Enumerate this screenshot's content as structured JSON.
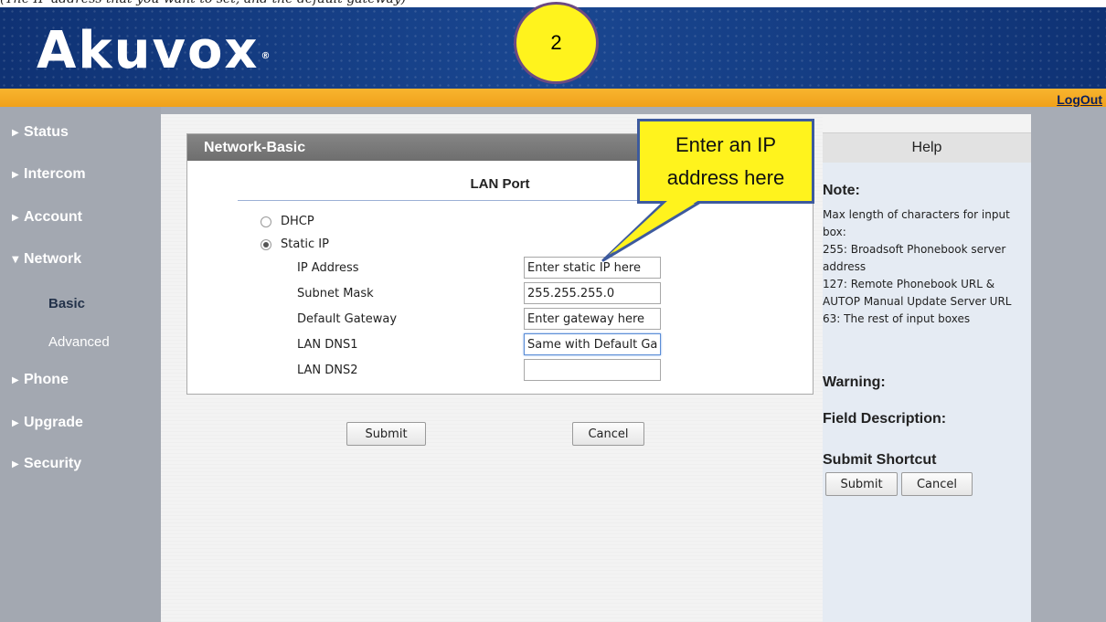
{
  "caption": "(The IP address that you want to set, and the default gateway)",
  "header": {
    "logo": "Akuvox",
    "logo_mark": "®",
    "step_badge": "2"
  },
  "top_bar": {
    "logout_label": "LogOut"
  },
  "sidebar": {
    "items": [
      {
        "label": "Status",
        "expanded": false
      },
      {
        "label": "Intercom",
        "expanded": false
      },
      {
        "label": "Account",
        "expanded": false
      },
      {
        "label": "Network",
        "expanded": true
      },
      {
        "label": "Phone",
        "expanded": false
      },
      {
        "label": "Upgrade",
        "expanded": false
      },
      {
        "label": "Security",
        "expanded": false
      }
    ],
    "subitems": [
      {
        "label": "Basic",
        "active": true
      },
      {
        "label": "Advanced",
        "active": false
      }
    ],
    "collapsed_glyph": "▶",
    "expanded_glyph": "▼"
  },
  "main": {
    "panel_title": "Network-Basic",
    "section_title": "LAN Port",
    "mode_options": [
      {
        "label": "DHCP",
        "selected": false
      },
      {
        "label": "Static IP",
        "selected": true
      }
    ],
    "fields": [
      {
        "label": "IP Address",
        "value": "Enter static IP here"
      },
      {
        "label": "Subnet Mask",
        "value": "255.255.255.0"
      },
      {
        "label": "Default Gateway",
        "value": "Enter gateway here"
      },
      {
        "label": "LAN DNS1",
        "value": "Same with Default Gat"
      },
      {
        "label": "LAN DNS2",
        "value": ""
      }
    ],
    "submit_label": "Submit",
    "cancel_label": "Cancel"
  },
  "help": {
    "title": "Help",
    "note_heading": "Note:",
    "note_lines": [
      "Max length of characters for input",
      "box:",
      "255: Broadsoft Phonebook server",
      "address",
      "127: Remote Phonebook URL &",
      "AUTOP Manual Update Server URL",
      "63: The rest of input boxes"
    ],
    "warning_heading": "Warning:",
    "field_desc_heading": "Field Description:",
    "shortcut_heading": "Submit Shortcut",
    "shortcut_submit": "Submit",
    "shortcut_cancel": "Cancel"
  },
  "callout": {
    "line1": "Enter an IP",
    "line2": "address here"
  },
  "colors": {
    "header_blue": "#143a7e",
    "orange_bar": "#f3a824",
    "sidebar_gray": "#a3a8b1",
    "callout_yellow": "#fff31d",
    "callout_border": "#3d5a9e",
    "help_bg": "#e5ebf3"
  }
}
